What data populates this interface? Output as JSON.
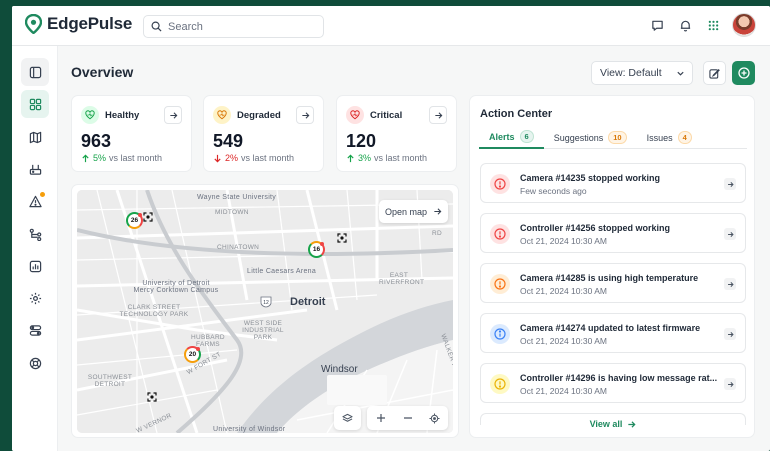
{
  "app": {
    "name": "EdgePulse"
  },
  "search": {
    "placeholder": "Search"
  },
  "page": {
    "title": "Overview"
  },
  "view_select": {
    "value": "View: Default"
  },
  "kpis": [
    {
      "name": "Healthy",
      "value": "963",
      "delta": "5%",
      "delta_suffix": "vs last month",
      "trend": "up",
      "color": "#16a34a"
    },
    {
      "name": "Degraded",
      "value": "549",
      "delta": "2%",
      "delta_suffix": "vs last month",
      "trend": "down",
      "color": "#f59e0b"
    },
    {
      "name": "Critical",
      "value": "120",
      "delta": "3%",
      "delta_suffix": "vs last month",
      "trend": "up",
      "color": "#ef4444"
    }
  ],
  "map": {
    "open_label": "Open map",
    "city_main": "Detroit",
    "city_second": "Windsor",
    "labels": {
      "wsu": "Wayne State University",
      "midtown": "MIDTOWN",
      "chinatown": "CHINATOWN",
      "arena": "Little Caesars Arena",
      "udm": "University of Detroit Mercy Corktown Campus",
      "clark": "CLARK STREET TECHNOLOGY PARK",
      "hubbard": "HUBBARD FARMS",
      "westside": "WEST SIDE INDUSTRIAL PARK",
      "southwest": "SOUTHWEST DETROIT",
      "eastriver": "EAST RIVERFRONT",
      "walker": "WALKER RD",
      "uwindsor": "University of Windsor",
      "fort": "W FORT ST",
      "vernor": "W VERNOR",
      "rd": "RD"
    },
    "markers": [
      {
        "label": "26",
        "status": "alert"
      },
      {
        "label": "16",
        "status": "alert"
      },
      {
        "label": "20",
        "status": "alert"
      }
    ],
    "shield_label": "12"
  },
  "action_center": {
    "title": "Action Center",
    "tabs": [
      {
        "label": "Alerts",
        "count": "6"
      },
      {
        "label": "Suggestions",
        "count": "10"
      },
      {
        "label": "Issues",
        "count": "4"
      }
    ],
    "alerts": [
      {
        "title": "Camera #14235 stopped working",
        "time": "Few seconds ago",
        "level": "critical",
        "color": "#ef4444"
      },
      {
        "title": "Controller #14256 stopped working",
        "time": "Oct 21, 2024   10:30 AM",
        "level": "critical",
        "color": "#ef4444"
      },
      {
        "title": "Camera #14285 is using high temperature",
        "time": "Oct 21, 2024   10:30 AM",
        "level": "warning",
        "color": "#f97316"
      },
      {
        "title": "Camera #14274 updated to latest firmware",
        "time": "Oct 21, 2024   10:30 AM",
        "level": "info",
        "color": "#3b82f6"
      },
      {
        "title": "Controller #14296 is having low message rat...",
        "time": "Oct 21, 2024   10:30 AM",
        "level": "caution",
        "color": "#eab308"
      }
    ],
    "view_all": "View all"
  },
  "colors": {
    "brand": "#1f8a5f",
    "topbar_bg": "#0f4c3a"
  }
}
